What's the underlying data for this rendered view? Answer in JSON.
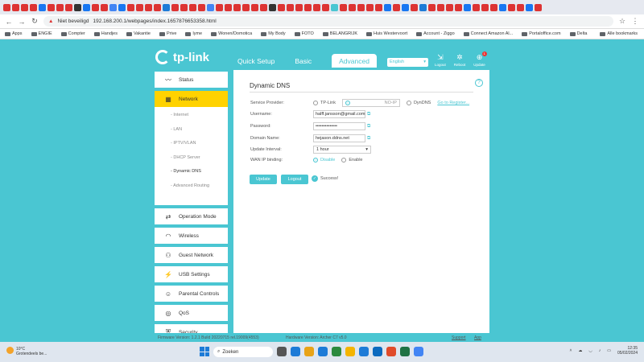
{
  "browser": {
    "address": "192.168.200.1/webpages/index.1657876653358.html",
    "not_secure": "Niet beveiligd",
    "bookmarks": [
      "Apps",
      "ENGIE",
      "Compter",
      "Handjes",
      "Vakantie",
      "Prive",
      "lyme",
      "Wonen/Domotica",
      "My Body",
      "FOTO",
      "BELANGRIJK",
      "Huis Westervoort",
      "Account - Ziggo",
      "Connect Amazon Al...",
      "Portaloffice.com",
      "Delta"
    ],
    "all_bookmarks": "Alle bookmarks",
    "tab_colors": [
      "#d33",
      "#d33",
      "#d33",
      "#d33",
      "#1877f2",
      "#d33",
      "#d33",
      "#d33",
      "#333",
      "#1877f2",
      "#d33",
      "#d33",
      "#4285f4",
      "#1877f2",
      "#d33",
      "#d33",
      "#d33",
      "#d33",
      "#1d7bd7",
      "#d33",
      "#d33",
      "#d33",
      "#d33",
      "#4285f4",
      "#d33",
      "#d33",
      "#d33",
      "#d33",
      "#d33",
      "#d33",
      "#333",
      "#d33",
      "#d33",
      "#d33",
      "#d33",
      "#d33",
      "#d33",
      "#4ac6d2",
      "#d33",
      "#d33",
      "#d33",
      "#d33",
      "#d33",
      "#1877f2",
      "#d33",
      "#1877f2",
      "#d33",
      "#1d7bd7",
      "#d33",
      "#d33",
      "#d33",
      "#d33",
      "#1877f2",
      "#d33",
      "#d33",
      "#d33",
      "#1877f2",
      "#d33",
      "#d33",
      "#1877f2",
      "#d33"
    ]
  },
  "router": {
    "logo": "tp-link",
    "tabs": [
      "Quick Setup",
      "Basic",
      "Advanced"
    ],
    "language": "English",
    "top_icons": [
      "Logout",
      "Reboot",
      "Update"
    ],
    "update_badge": "1",
    "sidebar": [
      {
        "label": "Status",
        "icon": "〰"
      },
      {
        "label": "Network",
        "icon": "▦"
      }
    ],
    "subnav": [
      "Internet",
      "LAN",
      "IPTV/VLAN",
      "DHCP Server",
      "Dynamic DNS",
      "Advanced Routing"
    ],
    "sidebar2": [
      {
        "label": "Operation Mode",
        "icon": "⇄"
      },
      {
        "label": "Wireless",
        "icon": "◠"
      },
      {
        "label": "Guest Network",
        "icon": "⚇"
      },
      {
        "label": "USB Settings",
        "icon": "⚡"
      },
      {
        "label": "Parental Controls",
        "icon": "☺"
      },
      {
        "label": "QoS",
        "icon": "◎"
      },
      {
        "label": "Security",
        "icon": "⛨"
      }
    ],
    "panel": {
      "title": "Dynamic DNS",
      "help": "?",
      "provider_label": "Service Provider:",
      "providers": [
        "TP-Link",
        "NO-IP",
        "DynDNS"
      ],
      "register": "Go to Register...",
      "username_label": "Username:",
      "username": "halff.jansson@gmail.com",
      "password_label": "Password:",
      "password": "••••••••••••••",
      "domain_label": "Domain Name:",
      "domain": "hejason.ddns.net",
      "interval_label": "Update Interval:",
      "interval": "1 hour",
      "wan_label": "WAN IP binding:",
      "wan": [
        "Disable",
        "Enable"
      ],
      "update_btn": "Update",
      "logout_btn": "Logout",
      "success": "Success!"
    },
    "footer": {
      "firmware": "Firmware Version: 1.2.1 Build 20220715 rel.19009(4553)",
      "hardware": "Hardware Version: Archer C7 v5.0",
      "support": "Support",
      "app": "App"
    }
  },
  "taskbar": {
    "temp": "10°C",
    "weather": "Grotendeels be...",
    "search": "Zoeken",
    "app_colors": [
      "#555",
      "#1d7bd7",
      "#e8a317",
      "#1d7bd7",
      "#2b8a3e",
      "#f4b400",
      "#1d7bd7",
      "#0b6abf",
      "#e04b2a",
      "#1f7244",
      "#4285f4"
    ],
    "time": "12:35",
    "date": "05/02/2024"
  }
}
